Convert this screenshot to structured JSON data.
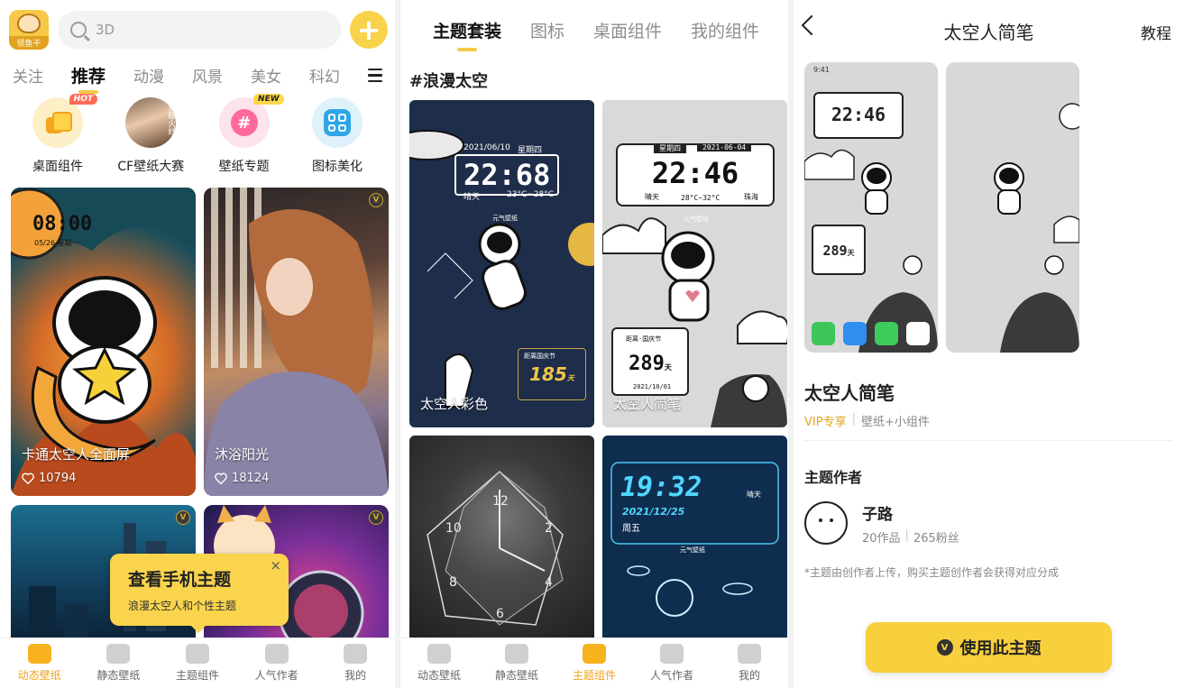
{
  "panel1": {
    "logo_text": "领鱼干",
    "search_placeholder": "3D",
    "plus_glyph": "+",
    "categories": [
      "关注",
      "推荐",
      "动漫",
      "风景",
      "美女",
      "科幻"
    ],
    "active_category": "推荐",
    "quick_items": [
      {
        "label": "桌面组件",
        "badge": "HOT"
      },
      {
        "label": "CF壁纸大赛",
        "badge": ""
      },
      {
        "label": "壁纸专题",
        "badge": "NEW"
      },
      {
        "label": "图标美化",
        "badge": ""
      }
    ],
    "cards": [
      {
        "title": "卡通太空人全面屏",
        "likes": "10794",
        "vip": "V"
      },
      {
        "title": "沐浴阳光",
        "likes": "18124",
        "vip": "V"
      },
      {
        "title": "",
        "likes": "",
        "vip": "V"
      },
      {
        "title": "",
        "likes": "",
        "vip": "V"
      }
    ],
    "card1_clock": "08:00",
    "card1_date": "05/26 星期一",
    "popup": {
      "title": "查看手机主题",
      "subtitle": "浪漫太空人和个性主题",
      "close": "×"
    },
    "tabbar": [
      "动态壁纸",
      "静态壁纸",
      "主题组件",
      "人气作者",
      "我的"
    ],
    "active_tab": "动态壁纸"
  },
  "panel2": {
    "tabs": [
      "主题套装",
      "图标",
      "桌面组件",
      "我的组件"
    ],
    "active_tab": "主题组件",
    "hashtag": "#浪漫太空",
    "thumbs": [
      {
        "title": "太空人彩色",
        "clock": "22:68",
        "date": "2021/06/10",
        "weekday": "星期四",
        "weather": "晴天",
        "temp": "23°C~28°C",
        "countdown": "185",
        "unit": "天",
        "event": "距离国庆节",
        "brand": "元气壁纸"
      },
      {
        "title": "太空人简笔",
        "clock": "22:46",
        "weekday": "星期四",
        "date": "2021-06-04",
        "weather": "晴天",
        "temp": "28°C~32°C",
        "city": "珠海",
        "countdown": "289",
        "unit": "天",
        "event": "距离·国庆节",
        "event_date": "2021/10/01",
        "brand": "元气壁纸"
      },
      {
        "title": "",
        "numbers": [
          "12",
          "2",
          "4",
          "6",
          "8",
          "10"
        ]
      },
      {
        "title": "",
        "clock": "19:32",
        "date": "2021/12/25",
        "weekday": "周五",
        "weather": "晴天",
        "brand": "元气壁纸"
      }
    ],
    "tabbar": [
      "动态壁纸",
      "静态壁纸",
      "主题组件",
      "人气作者",
      "我的"
    ]
  },
  "panel3": {
    "title": "太空人简笔",
    "help": "教程",
    "preview_time": "9:41",
    "preview_clock": "22:46",
    "preview_days": "289",
    "preview_days_unit": "天",
    "theme_name": "太空人简笔",
    "vip_label": "VIP专享",
    "meta_sep": "|",
    "theme_type": "壁纸+小组件",
    "author_heading": "主题作者",
    "author_name": "子路",
    "author_works": "20作品",
    "author_fans": "265粉丝",
    "note": "*主题由创作者上传，购买主题创作者会获得对应分成",
    "use_button": "使用此主题",
    "use_button_icon": "V"
  },
  "colors": {
    "accent": "#f7c948",
    "accent_dark": "#f0a21a",
    "vip": "#e0a51b"
  }
}
